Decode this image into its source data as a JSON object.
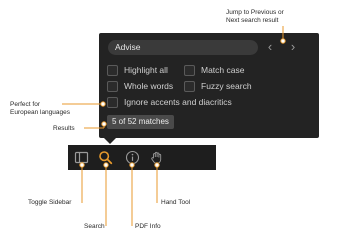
{
  "search": {
    "query": "Advise"
  },
  "nav": {
    "prev_icon": "chevron-left-icon",
    "next_icon": "chevron-right-icon",
    "prev_glyph": "‹",
    "next_glyph": "›"
  },
  "options": {
    "highlight_all": "Highlight all",
    "match_case": "Match case",
    "whole_words": "Whole words",
    "fuzzy_search": "Fuzzy search",
    "ignore_accents": "Ignore accents and diacritics"
  },
  "results": {
    "text": "5 of 52 matches"
  },
  "toolbar": {
    "icons": [
      "sidebar-toggle-icon",
      "search-icon",
      "info-icon",
      "hand-icon"
    ],
    "active_color": "#e89a2c",
    "icon_color": "#9a9a9a"
  },
  "callouts": {
    "jump_line1": "Jump to Previous or",
    "jump_line2": "Next search result",
    "perfect_line1": "Perfect for",
    "perfect_line2": "European languages",
    "results": "Results",
    "toggle_sidebar": "Toggle Sidebar",
    "search": "Search",
    "pdf_info": "PDF Info",
    "hand_tool": "Hand Tool"
  },
  "colors": {
    "accent": "#e89a2c",
    "panel": "#232323",
    "toolbar": "#1e1e1e"
  }
}
